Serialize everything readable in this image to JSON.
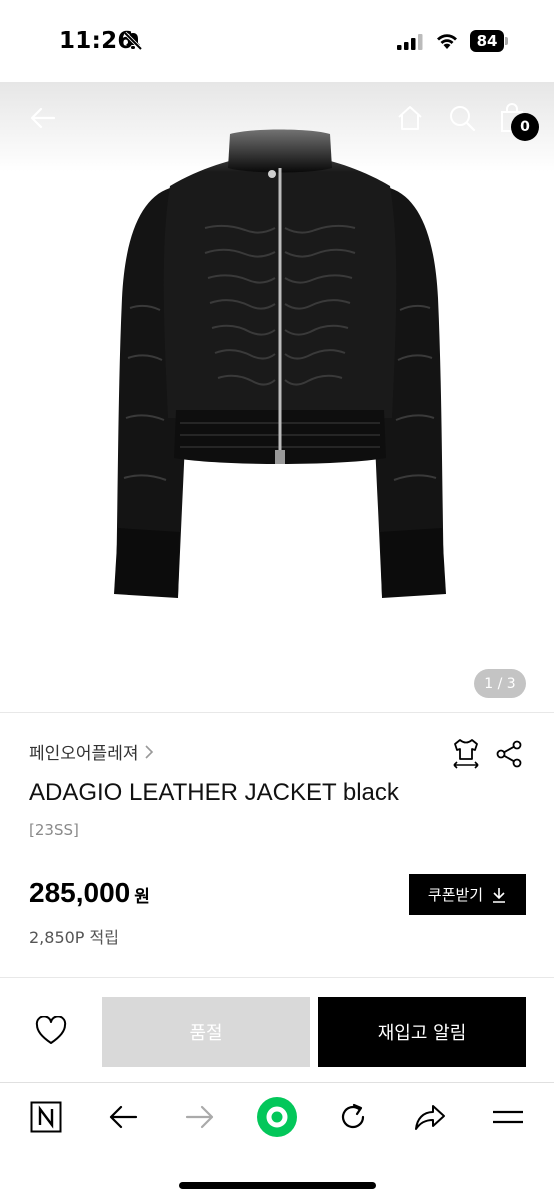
{
  "status_bar": {
    "time": "11:26",
    "battery": "84"
  },
  "header": {
    "cart_count": "0"
  },
  "gallery": {
    "indicator": "1 / 3"
  },
  "product": {
    "brand": "페인오어플레져",
    "title": "ADAGIO LEATHER JACKET black",
    "season": "[23SS]",
    "price": "285,000",
    "currency": "원",
    "points": "2,850P 적립"
  },
  "coupon": {
    "label": "쿠폰받기"
  },
  "actions": {
    "soldout_label": "품절",
    "restock_label": "재입고 알림"
  },
  "browser_toolbar": {
    "icons": [
      "naver-n-icon",
      "back-arrow-icon",
      "forward-arrow-icon",
      "green-dot-icon",
      "refresh-icon",
      "share-arrow-icon",
      "menu-icon"
    ]
  },
  "colors": {
    "accent_green": "#03c75a",
    "soldout_gray": "#d9d9d9",
    "black": "#000000"
  }
}
